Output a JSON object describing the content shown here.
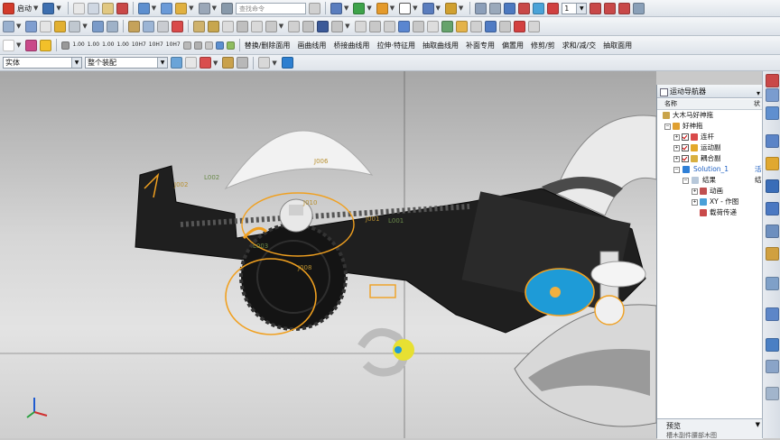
{
  "toolbar_row1": {
    "start_label": "启动",
    "search_placeholder": "查找命令",
    "frame_value": "1"
  },
  "toolbar_row2": {
    "buttons": [
      "1.00",
      "1.00",
      "1.00",
      "1.00",
      "10H7",
      "10H7",
      "10H7"
    ]
  },
  "toolbar_row3": {
    "buttons_left": [
      "1.00",
      "1.00",
      "1.00",
      "1.00",
      "10H7",
      "10H7",
      "10H7"
    ],
    "menus": [
      "替换/删除面用",
      "画曲线用",
      "桥接曲线用",
      "拉伸·特征用",
      "抽取曲线用",
      "补面专用",
      "偏置用",
      "修剪/剪",
      "求和/减/交",
      "抽取面用"
    ]
  },
  "filter_bar": {
    "type_filter": "实体",
    "assembly_filter": "整个装配"
  },
  "viewport": {
    "labels": [
      "L002",
      "J002",
      "L003",
      "J010",
      "J001",
      "L001",
      "J006",
      "J008"
    ]
  },
  "motion_navigator": {
    "title": "运动导航器",
    "col_name": "名称",
    "col_status": "状",
    "items": [
      {
        "label": "大木马好神拖"
      },
      {
        "label": "好神拖"
      },
      {
        "label": "连杆"
      },
      {
        "label": "运动副"
      },
      {
        "label": "耦合副"
      },
      {
        "label": "Solution_1",
        "status": "活"
      },
      {
        "label": "结果",
        "status": "结"
      },
      {
        "label": "动画"
      },
      {
        "label": "XY - 作图"
      },
      {
        "label": "载荷传递"
      }
    ],
    "preview_label": "预览",
    "preview_sub": "槽木副件腰部木图"
  },
  "colors": {
    "accent_orange": "#f0a020",
    "selection_blue": "#1e9bd7",
    "part_dark": "#1a1a1a"
  }
}
